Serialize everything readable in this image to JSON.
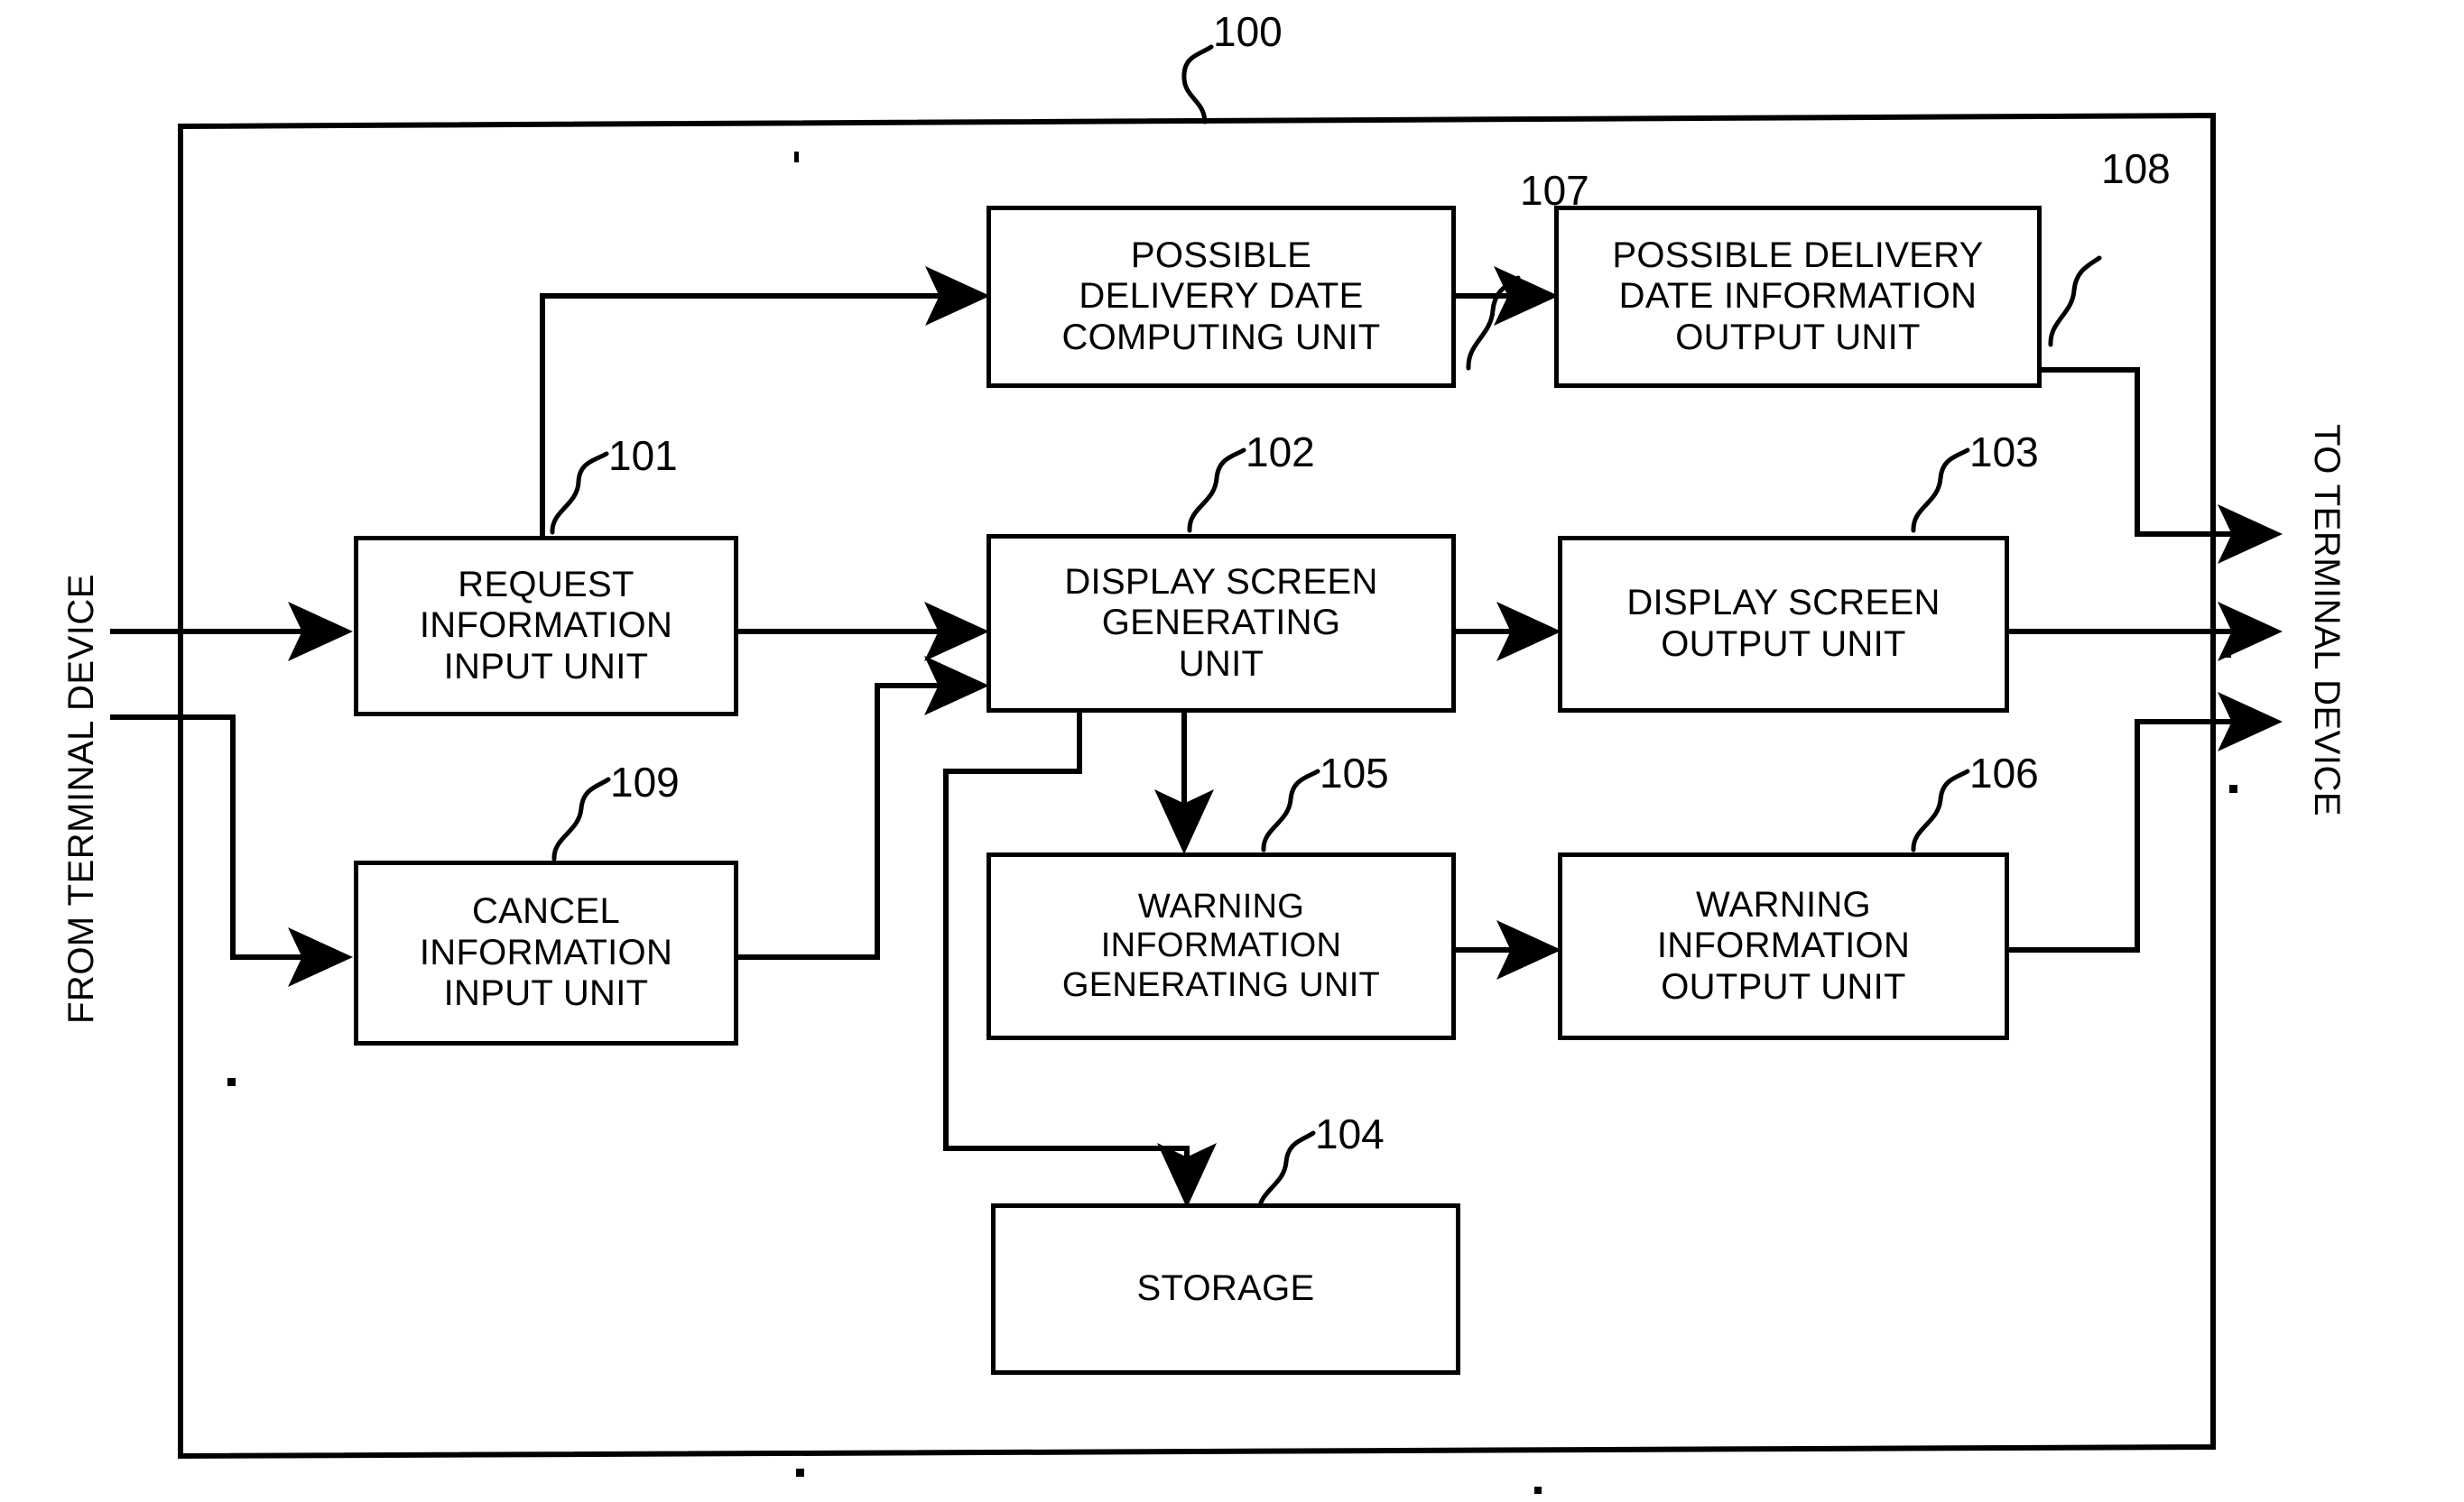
{
  "figure": {
    "type": "patent-block-diagram",
    "outer_system_ref": "100",
    "left_caption": "FROM TERMINAL DEVICE",
    "right_caption": "TO TERMINAL DEVICE"
  },
  "units": [
    {
      "ref": "101",
      "label": "REQUEST\nINFORMATION\nINPUT UNIT"
    },
    {
      "ref": "102",
      "label": "DISPLAY SCREEN\nGENERATING\nUNIT"
    },
    {
      "ref": "103",
      "label": "DISPLAY SCREEN\nOUTPUT UNIT"
    },
    {
      "ref": "104",
      "label": "STORAGE"
    },
    {
      "ref": "105",
      "label": "WARNING\nINFORMATION\nGENERATING UNIT"
    },
    {
      "ref": "106",
      "label": "WARNING\nINFORMATION\nOUTPUT UNIT"
    },
    {
      "ref": "107",
      "label": "POSSIBLE\nDELIVERY DATE\nCOMPUTING UNIT"
    },
    {
      "ref": "108",
      "label": "POSSIBLE DELIVERY\nDATE INFORMATION\nOUTPUT UNIT"
    },
    {
      "ref": "109",
      "label": "CANCEL\nINFORMATION\nINPUT UNIT"
    }
  ],
  "connections": [
    {
      "from": "terminal-in",
      "to": "101"
    },
    {
      "from": "terminal-in",
      "to": "109"
    },
    {
      "from": "101",
      "to": "107"
    },
    {
      "from": "101",
      "to": "102"
    },
    {
      "from": "109",
      "to": "102"
    },
    {
      "from": "107",
      "to": "108"
    },
    {
      "from": "102",
      "to": "103"
    },
    {
      "from": "102",
      "to": "105"
    },
    {
      "from": "102",
      "to": "104"
    },
    {
      "from": "105",
      "to": "106"
    },
    {
      "from": "108",
      "to": "terminal-out"
    },
    {
      "from": "103",
      "to": "terminal-out"
    },
    {
      "from": "106",
      "to": "terminal-out"
    }
  ],
  "colors": {
    "line": "#000000",
    "background": "#ffffff"
  }
}
